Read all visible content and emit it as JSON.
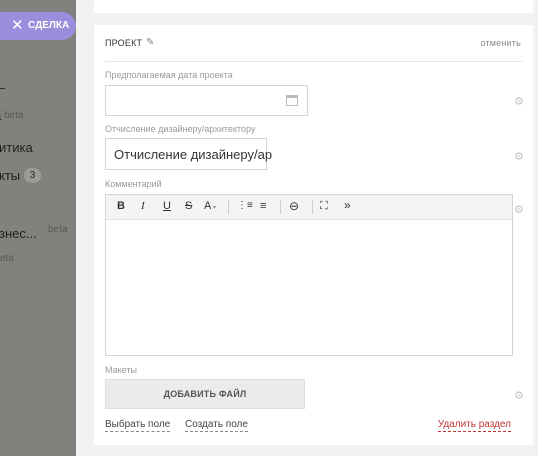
{
  "sidebar": {
    "close_button": "СДЕЛКА",
    "items": [
      {
        "label": "–"
      },
      {
        "label": "а",
        "beta": "beta"
      },
      {
        "label": "итика"
      },
      {
        "label": "кты",
        "badge": "3"
      },
      {
        "label": "знес...",
        "beta": "beta"
      },
      {
        "label": "",
        "beta": "eta"
      }
    ]
  },
  "section": {
    "title": "ПРОЕКТ",
    "cancel": "отменить"
  },
  "fields": {
    "date_label": "Предполагаемая дата проекта",
    "date_value": "",
    "deduction_label": "Отчисление дизайнеру/архитектору",
    "deduction_value": "Отчисление дизайнеру/ар",
    "comment_label": "Комментарий",
    "mockups_label": "Макеты",
    "add_file": "ДОБАВИТЬ ФАЙЛ"
  },
  "toolbar": {
    "bold": "B",
    "italic": "I",
    "underline": "U",
    "strike": "S",
    "font_color": "A",
    "ordered_list": "⋮≡",
    "unordered_list": "≡",
    "link": "⊖",
    "fullscreen": "⛶",
    "more": "»"
  },
  "footer": {
    "choose_field": "Выбрать поле",
    "create_field": "Создать поле",
    "delete_section": "Удалить раздел"
  }
}
